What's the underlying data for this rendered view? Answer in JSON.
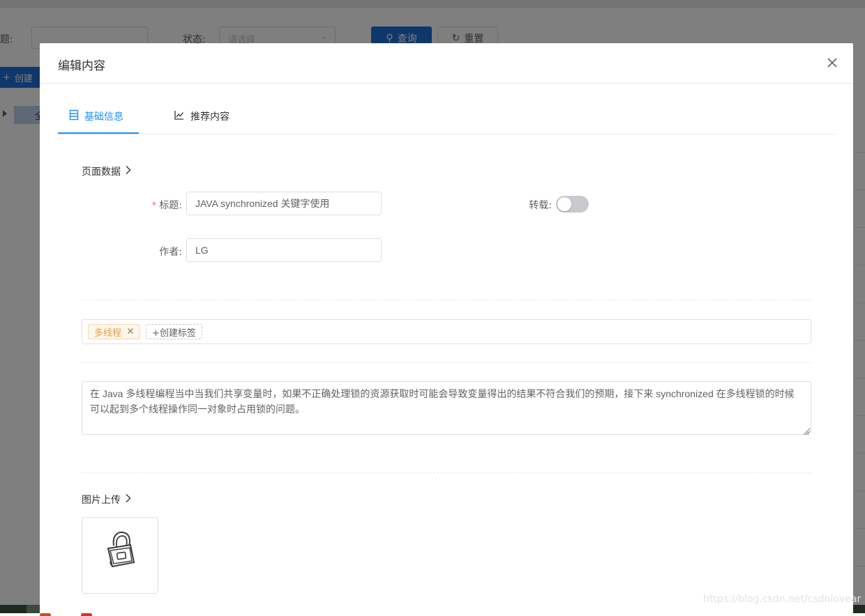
{
  "background": {
    "filter_title_label": "标题:",
    "filter_status_label": "状态:",
    "status_placeholder": "请选择",
    "query_button": "查询",
    "reset_button": "重置",
    "create_button": "创建",
    "tree_node": "全"
  },
  "dialog": {
    "title": "编辑内容",
    "tabs": [
      {
        "label": "基础信息",
        "icon": "list-icon",
        "active": true
      },
      {
        "label": "推荐内容",
        "icon": "line-chart-icon",
        "active": false
      }
    ],
    "page_data_section": "页面数据",
    "title_field": {
      "label": "标题:",
      "value": "JAVA synchronized 关键字使用"
    },
    "repost_field": {
      "label": "转载:",
      "enabled": false
    },
    "author_field": {
      "label": "作者:",
      "value": "LG"
    },
    "tags": [
      "多线程"
    ],
    "create_tag_label": "+创建标签",
    "description": "在 Java 多线程编程当中当我们共享变量时，如果不正确处理锁的资源获取时可能会导致变量得出的结果不符合我们的预期，接下来 synchronized 在多线程锁的时候可以起到多个线程操作同一对象时占用锁的问题。",
    "image_section": "图片上传",
    "uploaded_image_icon": "padlock-icon"
  },
  "watermark": "https://blog.csdn.net/csdnlovear",
  "colors": {
    "primary": "#1890ff",
    "tag_warning_bg": "#fdf6ec",
    "tag_warning_text": "#e6a23c",
    "required": "#f56c6c"
  }
}
